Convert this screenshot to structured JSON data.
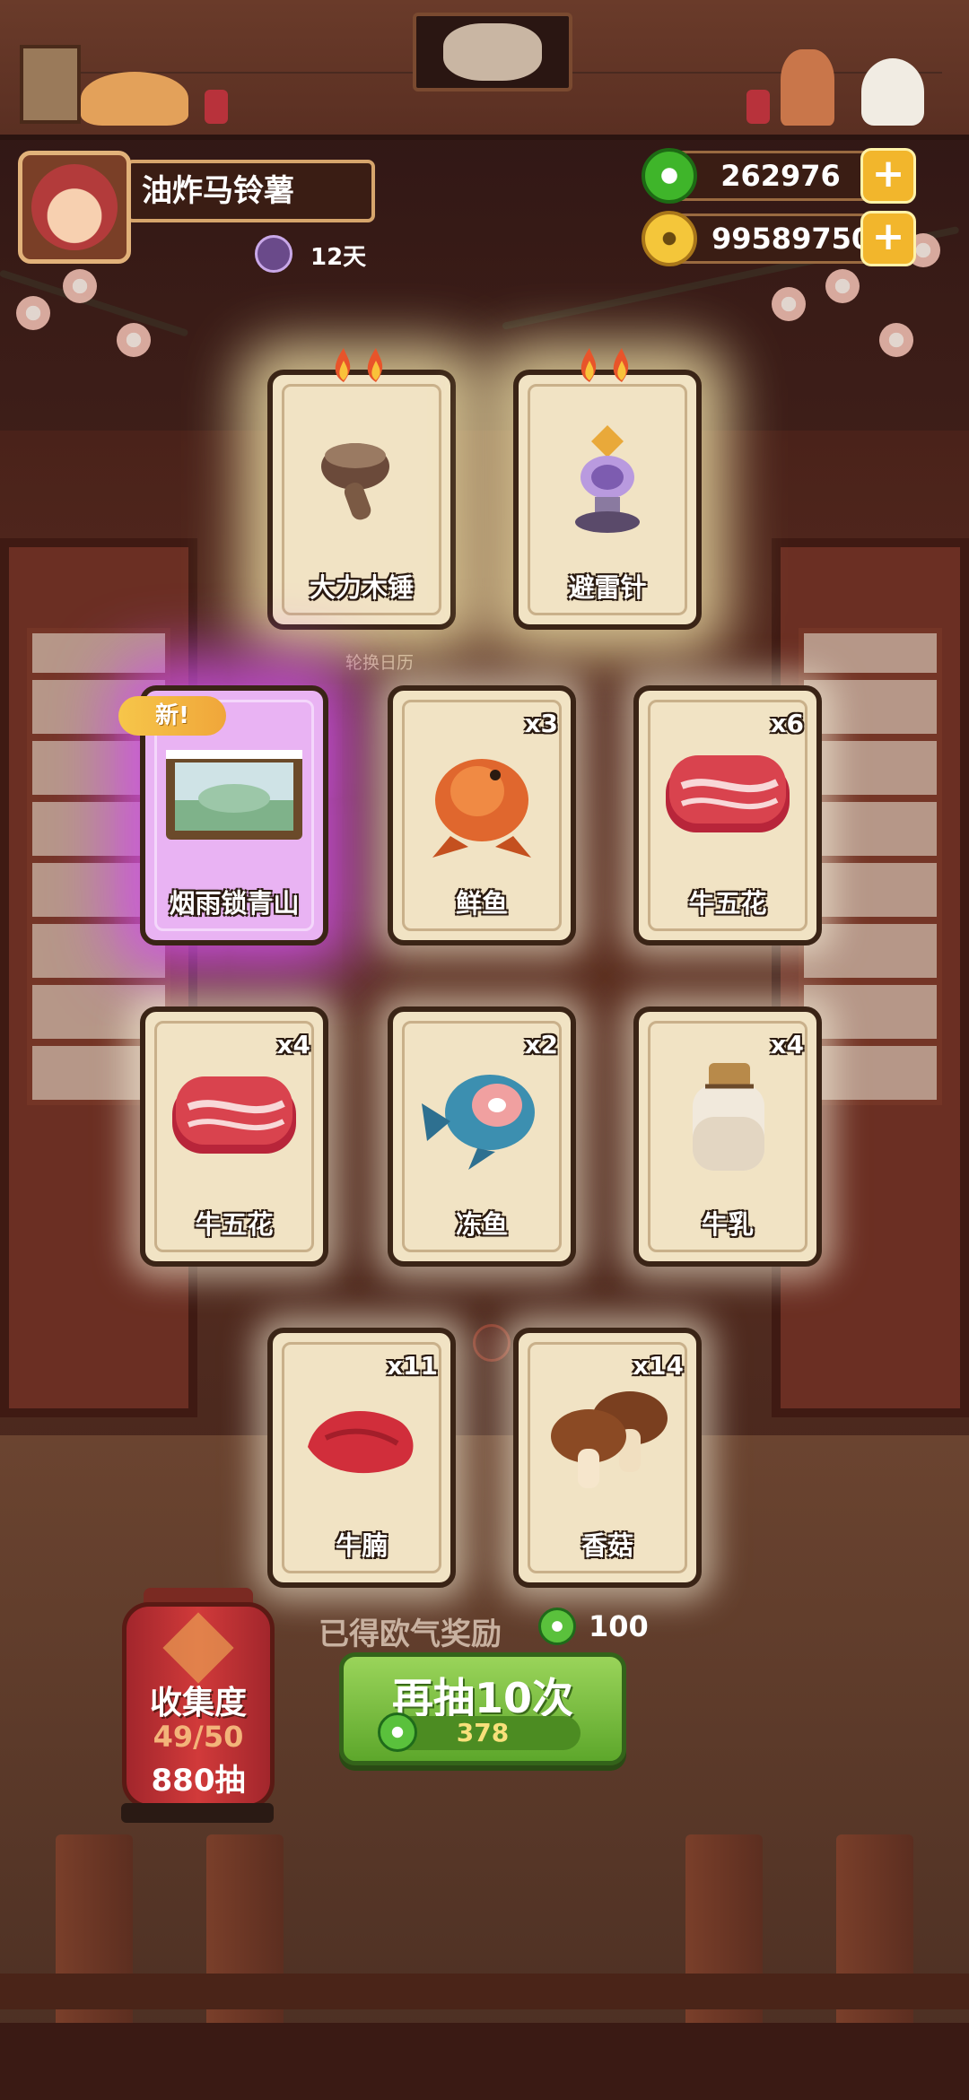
{
  "player": {
    "name": "油炸马铃薯",
    "days": "12天"
  },
  "currency": {
    "jade": "262976",
    "coins": "99589750"
  },
  "background_label": "轮换日历",
  "cards": [
    {
      "name": "大力木锤",
      "count": "",
      "rarity": "gold",
      "icon": "wooden-hammer-icon"
    },
    {
      "name": "避雷针",
      "count": "",
      "rarity": "gold",
      "icon": "lightning-rod-icon"
    },
    {
      "name": "烟雨锁青山",
      "count": "",
      "rarity": "purple",
      "badge": "新!",
      "icon": "scenery-painting-icon"
    },
    {
      "name": "鲜鱼",
      "count": "x3",
      "rarity": "normal",
      "icon": "fresh-fish-icon"
    },
    {
      "name": "牛五花",
      "count": "x6",
      "rarity": "normal",
      "icon": "beef-belly-icon"
    },
    {
      "name": "牛五花",
      "count": "x4",
      "rarity": "normal",
      "icon": "beef-belly-icon"
    },
    {
      "name": "冻鱼",
      "count": "x2",
      "rarity": "normal",
      "icon": "frozen-fish-icon"
    },
    {
      "name": "牛乳",
      "count": "x4",
      "rarity": "normal",
      "icon": "milk-jar-icon"
    },
    {
      "name": "牛腩",
      "count": "x11",
      "rarity": "normal",
      "icon": "beef-brisket-icon"
    },
    {
      "name": "香菇",
      "count": "x14",
      "rarity": "normal",
      "icon": "mushroom-icon"
    }
  ],
  "reward": {
    "label": "已得欧气奖励",
    "value": "100"
  },
  "draw_button": {
    "label": "再抽10次",
    "cost": "378"
  },
  "collection": {
    "title": "收集度",
    "progress": "49/50",
    "draws": "880抽"
  },
  "colors": {
    "accent_green": "#6cbf35",
    "gold": "#f2b62c",
    "purple_glow": "#cd50e6"
  }
}
